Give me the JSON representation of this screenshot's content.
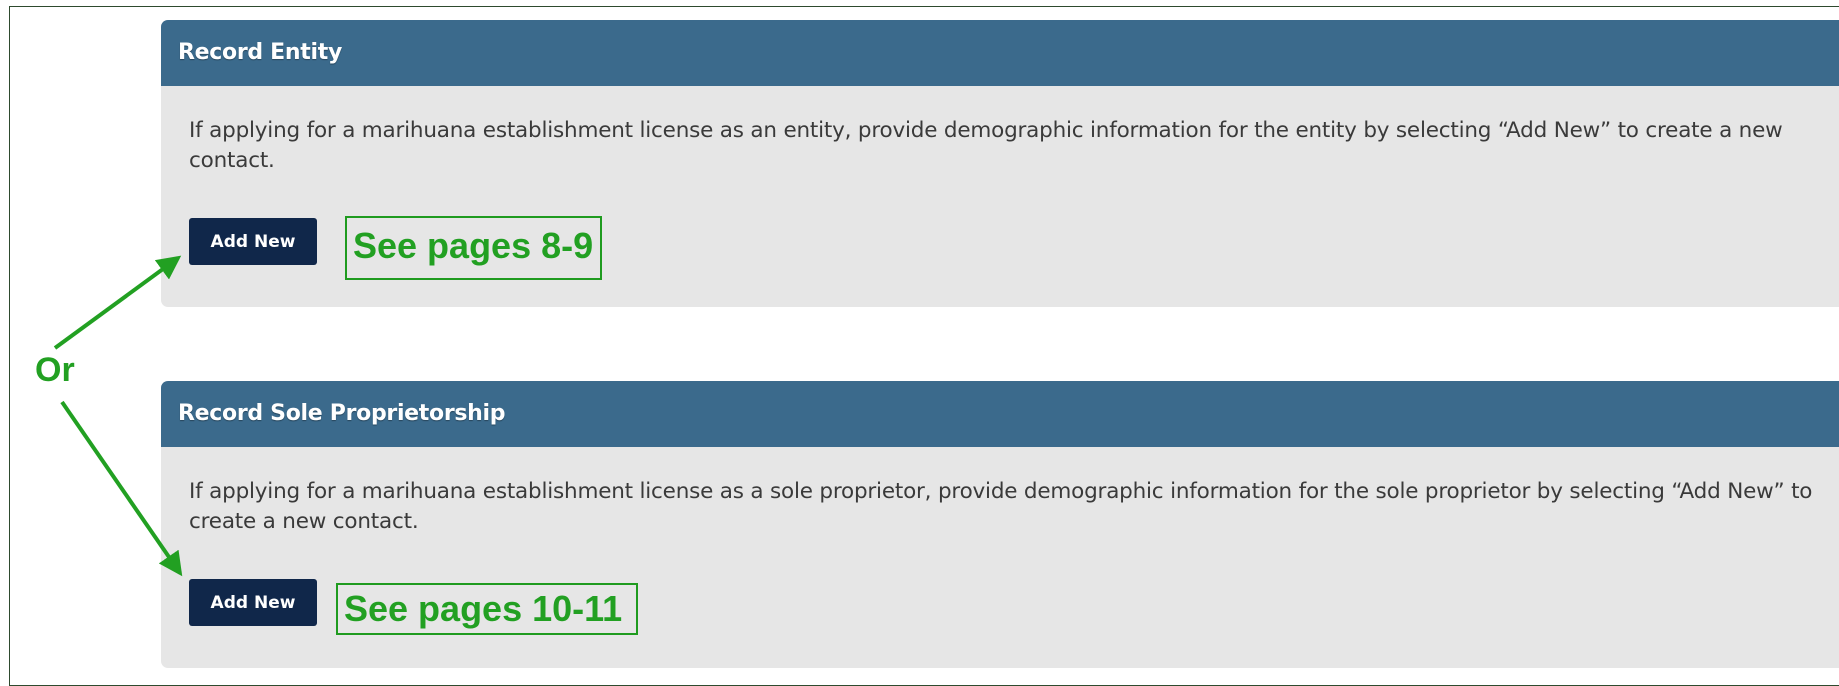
{
  "sections": {
    "entity": {
      "title": "Record Entity",
      "description": "If applying for a marihuana establishment license as an entity, provide demographic information for the entity by selecting “Add New” to create a new contact.",
      "button_label": "Add New",
      "annotation": "See pages 8-9"
    },
    "sole": {
      "title": "Record Sole Proprietorship",
      "description": "If applying for a marihuana establishment license as a sole proprietor, provide demographic information for the sole proprietor by selecting “Add New” to create a new contact.",
      "button_label": "Add New",
      "annotation": "See pages 10-11"
    }
  },
  "or_label": "Or",
  "colors": {
    "header": "#3b6a8c",
    "panel_bg": "#e6e6e6",
    "button": "#10274a",
    "annotation": "#22a022"
  }
}
